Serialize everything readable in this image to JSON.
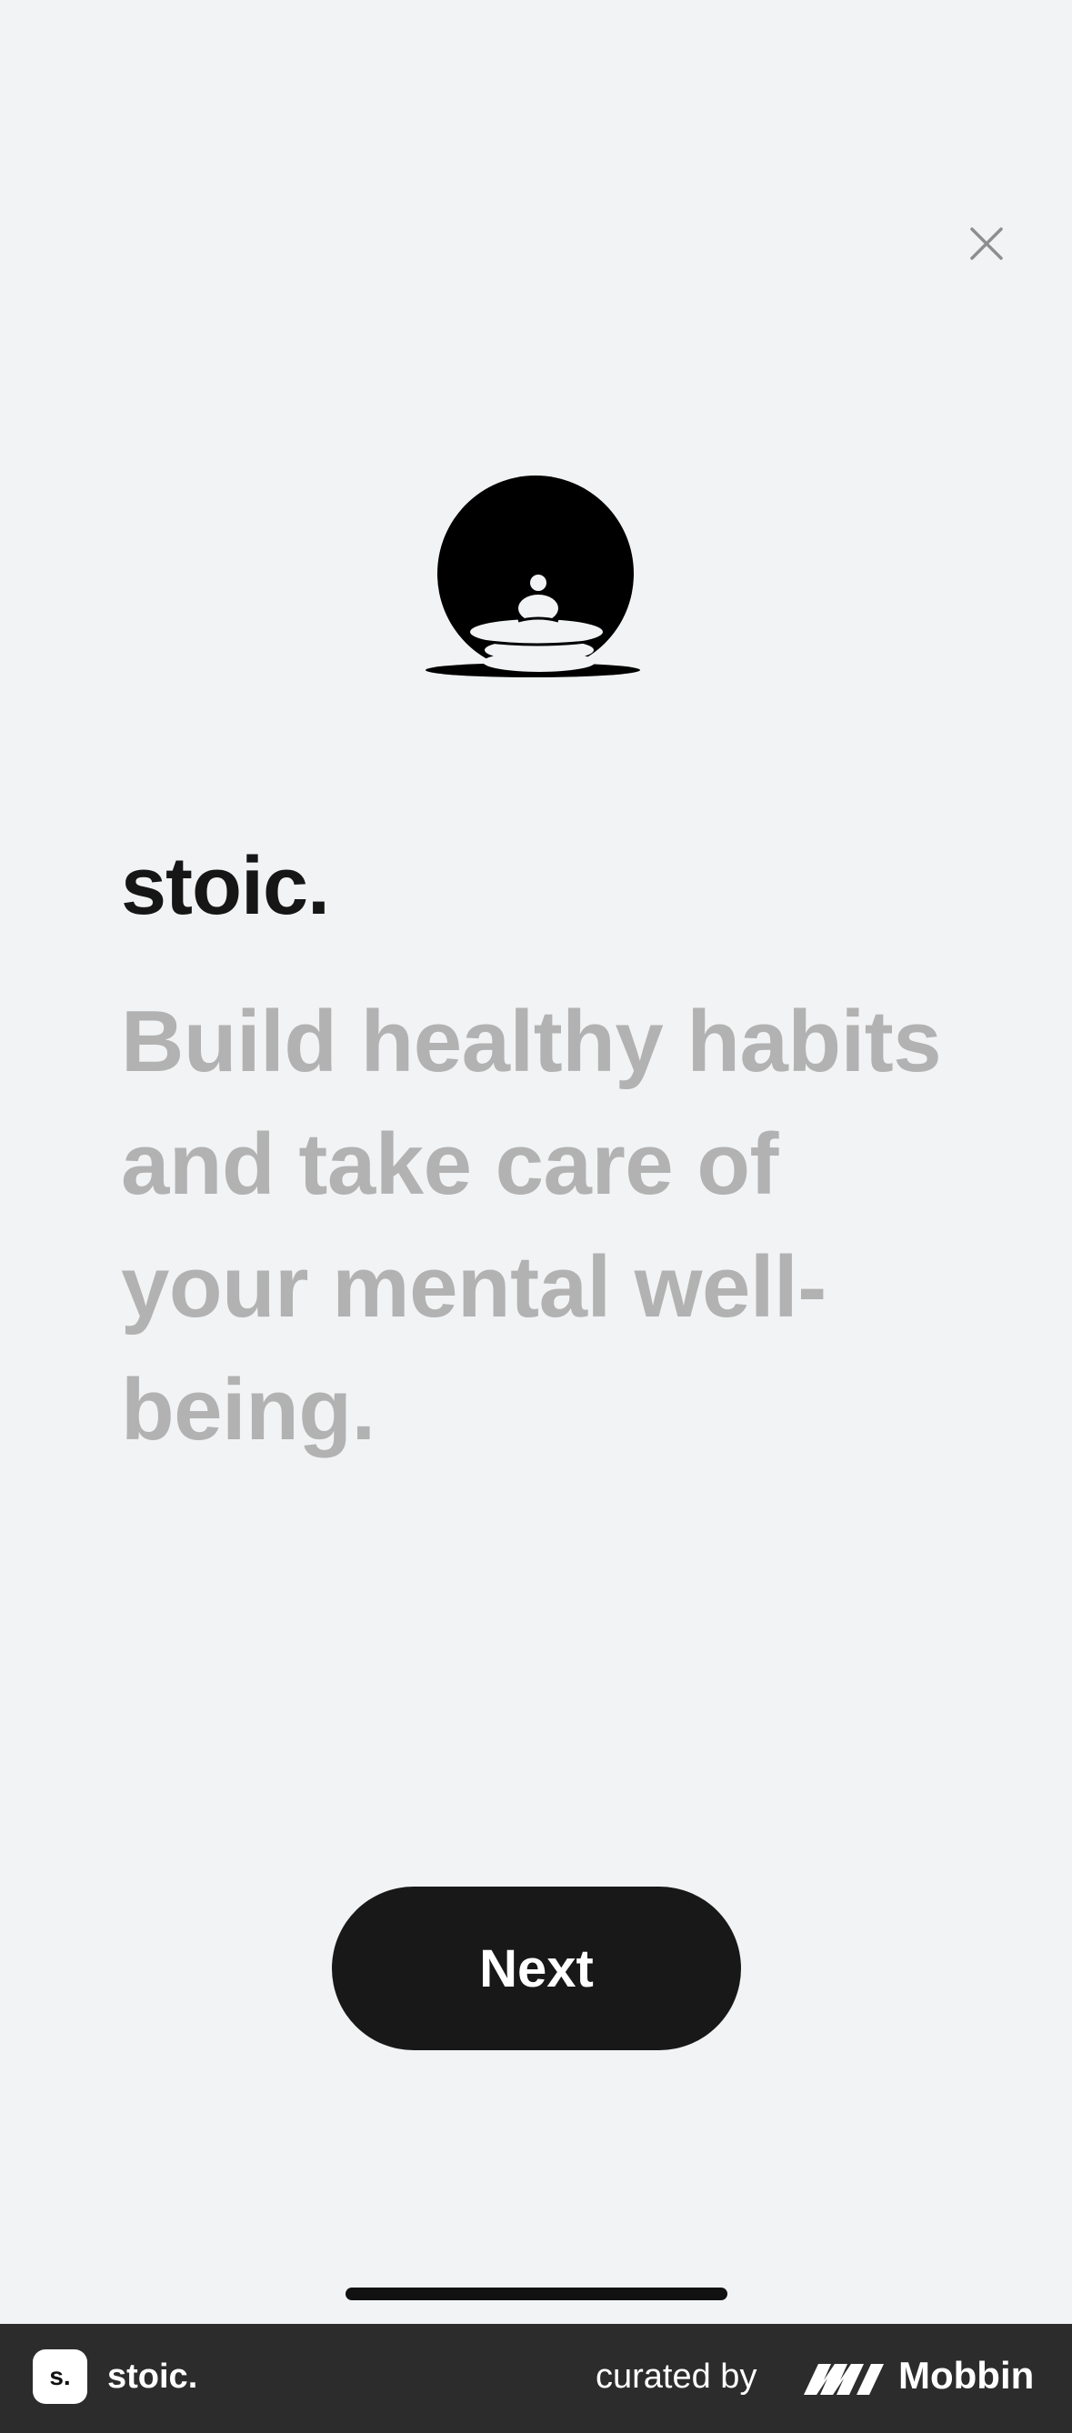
{
  "header": {
    "close_icon": "close-icon"
  },
  "hero": {
    "logo_icon": "meditation-stones-logo"
  },
  "content": {
    "brand": "stoic.",
    "tagline": "Build healthy habits and take care of your mental well-being."
  },
  "actions": {
    "next_label": "Next"
  },
  "footer": {
    "app_icon_text": "s.",
    "app_name": "stoic.",
    "curated_by": "curated by",
    "brand_name": "Mobbin"
  },
  "colors": {
    "background": "#f2f3f4",
    "primary_text": "#161616",
    "secondary_text": "#b2b2b2",
    "button_bg": "#181818",
    "footer_bg": "#2c2c2c"
  }
}
